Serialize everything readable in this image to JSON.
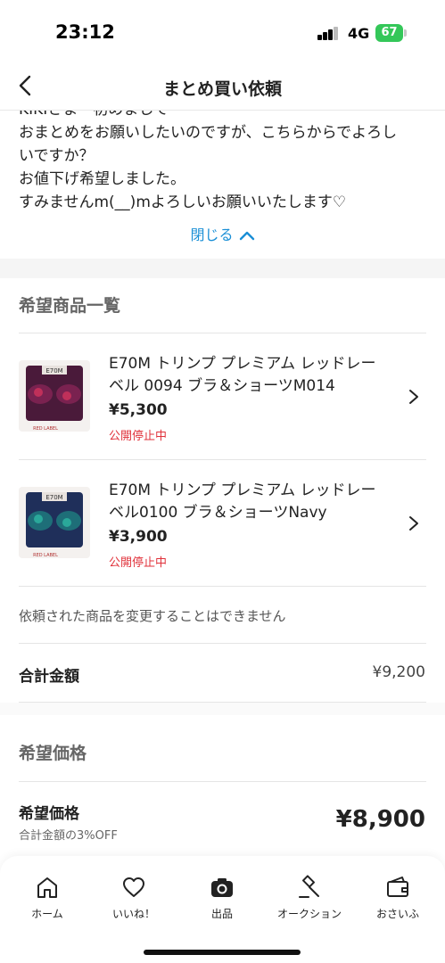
{
  "status_bar": {
    "time": "23:12",
    "network": "4G",
    "battery": "67"
  },
  "header": {
    "title": "まとめ買い依頼"
  },
  "message": {
    "lines": [
      "KIKIさま　初めましてᐠ-ᐟ",
      "おまとめをお願いしたいのですが、こちらからでよろし",
      "いですか？",
      "お値下げ希望しました。",
      "すみませんm(__)mよろしいお願いいたします♡"
    ],
    "close_label": "閉じる"
  },
  "products_section": {
    "title": "希望商品一覧",
    "items": [
      {
        "name": "E70M トリンプ プレミアム レッドレーベル 0094 ブラ＆ショーツM014",
        "price": "¥5,300",
        "status": "公開停止中",
        "thumb_brand": "E70M",
        "thumb_label": "RED LABEL",
        "thumb_color": "#4a1a3a"
      },
      {
        "name": "E70M トリンプ プレミアム レッドレーベル0100 ブラ＆ショーツNavy",
        "price": "¥3,900",
        "status": "公開停止中",
        "thumb_brand": "E70M",
        "thumb_label": "RED LABEL",
        "thumb_color": "#1f2f5a"
      }
    ],
    "note": "依頼された商品を変更することはできません"
  },
  "total": {
    "label": "合計金額",
    "value": "¥9,200"
  },
  "desired_section": {
    "title": "希望価格",
    "label": "希望価格",
    "sub_label": "合計金額の3%OFF",
    "value": "¥8,900"
  },
  "tabbar": {
    "items": [
      {
        "label": "ホーム",
        "icon": "home-icon"
      },
      {
        "label": "いいね！",
        "icon": "heart-icon"
      },
      {
        "label": "出品",
        "icon": "camera-icon"
      },
      {
        "label": "オークション",
        "icon": "gavel-icon"
      },
      {
        "label": "おさいふ",
        "icon": "wallet-icon"
      }
    ]
  },
  "colors": {
    "accent_link": "#1a8fd6",
    "status_red": "#e0313a",
    "battery_green": "#34c759"
  }
}
